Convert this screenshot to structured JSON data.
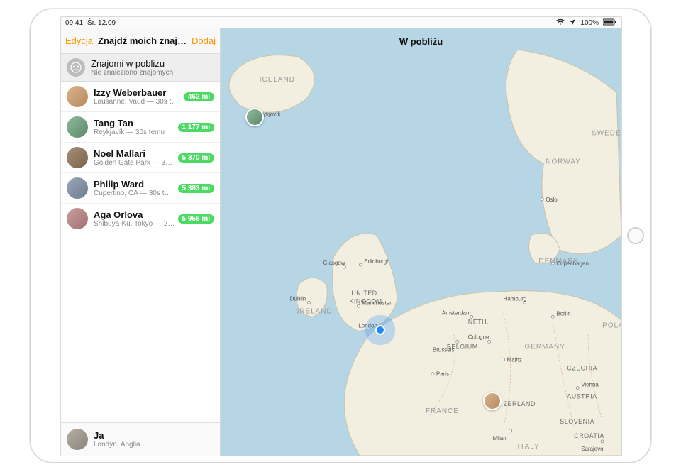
{
  "status": {
    "time": "09:41",
    "date": "Śr. 12.09",
    "battery": "100%"
  },
  "nav": {
    "edit": "Edycja",
    "title": "Znajdź moich znaj…",
    "add": "Dodaj"
  },
  "nearby_header": {
    "title": "Znajomi w pobliżu",
    "subtitle": "Nie znaleziono znajomych"
  },
  "friends": [
    {
      "name": "Izzy Weberbauer",
      "sub": "Lausanne, Vaud — 30s temu",
      "badge": "462 mi"
    },
    {
      "name": "Tang Tan",
      "sub": "Reykjavík — 30s temu",
      "badge": "1 177 mi"
    },
    {
      "name": "Noel Mallari",
      "sub": "Golden Gate Park — 30s temu",
      "badge": "5 370 mi"
    },
    {
      "name": "Philip Ward",
      "sub": "Cupertino, CA — 30s temu",
      "badge": "5 383 mi"
    },
    {
      "name": "Aga Orlova",
      "sub": "Shibuya-Ku, Tokyo — 2min temu",
      "badge": "5 956 mi"
    }
  ],
  "me": {
    "name": "Ja",
    "sub": "Londyn, Anglia"
  },
  "map": {
    "title": "W pobliżu",
    "countries": {
      "iceland": "ICELAND",
      "norway": "NORWAY",
      "sweden": "SWEDEN",
      "denmark": "DENMARK",
      "uk": "UNITED\nKINGDOM",
      "ireland": "IRELAND",
      "france": "FRANCE",
      "germany": "GERMANY",
      "poland": "POLAND",
      "belgium": "BELGIUM",
      "neth": "NETH.",
      "switz": "ZERLAND",
      "austria": "AUSTRIA",
      "czech": "CZECHIA",
      "slovenia": "SLOVENIA",
      "croatia": "CROATIA",
      "italy": "ITALY"
    },
    "cities": {
      "reykjavik": "Reykjavík",
      "oslo": "Oslo",
      "copenhagen": "Copenhagen",
      "glasgow": "Glasgow",
      "edinburgh": "Edinburgh",
      "dublin": "Dublin",
      "manchester": "Manchester",
      "london": "London",
      "paris": "Paris",
      "cologne": "Cologne",
      "berlin": "Berlin",
      "hamburg": "Hamburg",
      "amsterdam": "Amsterdam",
      "brussels": "Brussels",
      "mainz": "Mainz",
      "milan": "Milan",
      "vienna": "Vienna",
      "sarajevo": "Sarajevo"
    }
  }
}
